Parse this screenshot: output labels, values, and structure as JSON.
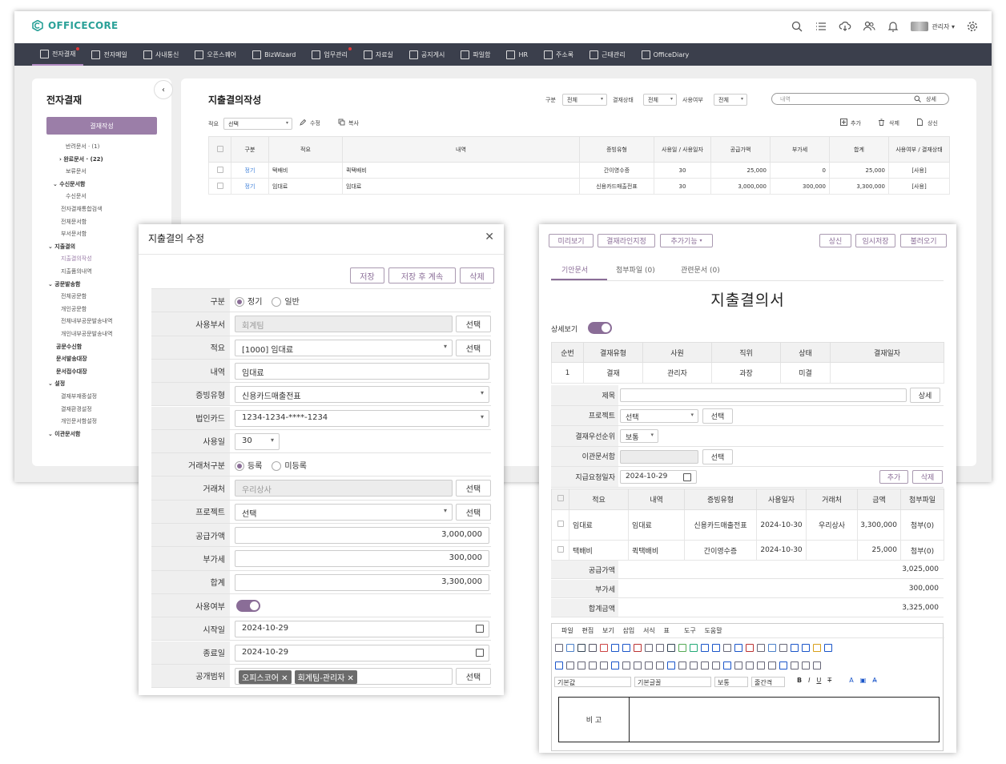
{
  "app": {
    "logo": "OFFICECORE",
    "user": "관리자 ▾"
  },
  "nav": [
    {
      "label": "전자결재",
      "dot": true
    },
    {
      "label": "전자메일",
      "dot": false
    },
    {
      "label": "사내통신",
      "dot": false
    },
    {
      "label": "오픈스퀘어",
      "dot": false
    },
    {
      "label": "BizWizard",
      "dot": false
    },
    {
      "label": "업무관리",
      "dot": true
    },
    {
      "label": "자료실",
      "dot": false
    },
    {
      "label": "공지게시",
      "dot": false
    },
    {
      "label": "파일함",
      "dot": false
    },
    {
      "label": "HR",
      "dot": false
    },
    {
      "label": "주소록",
      "dot": false
    },
    {
      "label": "근태관리",
      "dot": false
    },
    {
      "label": "OfficeDiary",
      "dot": false
    }
  ],
  "sidebar": {
    "title": "전자결재",
    "write": "결재작성",
    "items": [
      {
        "label": "반려문서 · (1)",
        "indent": 24,
        "style": ""
      },
      {
        "label": "› 완료문서 · (22)",
        "indent": 16,
        "style": "b"
      },
      {
        "label": "보류문서",
        "indent": 24,
        "style": ""
      },
      {
        "label": "⌄ 수신문서함",
        "indent": 8,
        "style": "b"
      },
      {
        "label": "수신문서",
        "indent": 24,
        "style": ""
      },
      {
        "label": "전자결재통합검색",
        "indent": 18,
        "style": ""
      },
      {
        "label": "전체문서함",
        "indent": 18,
        "style": ""
      },
      {
        "label": "부서문서함",
        "indent": 18,
        "style": ""
      },
      {
        "label": "⌄ 지출결의",
        "indent": 2,
        "style": "b"
      },
      {
        "label": "지출결의작성",
        "indent": 18,
        "style": "act"
      },
      {
        "label": "지출품의내역",
        "indent": 18,
        "style": ""
      },
      {
        "label": "⌄ 공문발송함",
        "indent": 2,
        "style": "b"
      },
      {
        "label": "전체공문함",
        "indent": 18,
        "style": ""
      },
      {
        "label": "개인공문함",
        "indent": 18,
        "style": ""
      },
      {
        "label": "전체내부공문발송내역",
        "indent": 18,
        "style": ""
      },
      {
        "label": "개인내부공문발송내역",
        "indent": 18,
        "style": ""
      },
      {
        "label": "공문수신함",
        "indent": 12,
        "style": "b"
      },
      {
        "label": "문서발송대장",
        "indent": 12,
        "style": "b"
      },
      {
        "label": "문서접수대장",
        "indent": 12,
        "style": "b"
      },
      {
        "label": "⌄ 설정",
        "indent": 2,
        "style": "b"
      },
      {
        "label": "결재부재중설정",
        "indent": 18,
        "style": ""
      },
      {
        "label": "결재환경설정",
        "indent": 18,
        "style": ""
      },
      {
        "label": "개인문서함설정",
        "indent": 18,
        "style": ""
      },
      {
        "label": "⌄ 이관문서함",
        "indent": 2,
        "style": "b"
      }
    ]
  },
  "list": {
    "title": "지출결의작성",
    "filters": {
      "gubun_label": "구분",
      "gubun": "전체",
      "status_label": "결재상태",
      "status": "전체",
      "use_label": "사용여부",
      "use": "전체"
    },
    "search_placeholder": "내역",
    "detail": "상세",
    "jeokyo_label": "적요",
    "jeokyo": "선택",
    "edit": "수정",
    "copy": "복사",
    "add": "추가",
    "delete": "삭제",
    "submit": "상신",
    "headers": [
      "구분",
      "적요",
      "내역",
      "증빙유형",
      "사용일 / 사용일자",
      "공급가액",
      "부가세",
      "합계",
      "사용여부 / 결재상태"
    ],
    "rows": [
      [
        "정기",
        "택배비",
        "퀵택배비",
        "간이영수증",
        "30",
        "25,000",
        "0",
        "25,000",
        "[사용]"
      ],
      [
        "정기",
        "임대료",
        "임대료",
        "신용카드매출전표",
        "30",
        "3,000,000",
        "300,000",
        "3,300,000",
        "[사용]"
      ]
    ]
  },
  "dialog": {
    "title": "지출결의 수정",
    "save": "저장",
    "save_continue": "저장 후 계속",
    "delete": "삭제",
    "select": "선택",
    "labels": {
      "gubun": "구분",
      "dept": "사용부서",
      "jeokyo": "적요",
      "detail": "내역",
      "proof": "증빙유형",
      "card": "법인카드",
      "useday": "사용일",
      "tradetype": "거래처구분",
      "vendor": "거래처",
      "project": "프로젝트",
      "supply": "공급가액",
      "vat": "부가세",
      "total": "합계",
      "use": "사용여부",
      "start": "시작일",
      "end": "종료일",
      "scope": "공개범위"
    },
    "gubun_opts": [
      "정기",
      "일반"
    ],
    "dept": "회계팀",
    "jeokyo": "[1000] 임대료",
    "detail": "임대료",
    "proof": "신용카드매출전표",
    "card": "1234-1234-****-1234",
    "useday": "30",
    "trade_opts": [
      "등록",
      "미등록"
    ],
    "vendor": "우리상사",
    "project": "선택",
    "supply": "3,000,000",
    "vat": "300,000",
    "total": "3,300,000",
    "start": "2024-10-29",
    "end": "2024-10-29",
    "scope_tags": [
      "오피스코어",
      "회계팀-관리자"
    ]
  },
  "right": {
    "preview": "미리보기",
    "approval_line": "결재라인지정",
    "extra": "추가기능",
    "submit": "상신",
    "temp_save": "임시저장",
    "load": "불러오기",
    "tabs": [
      "기안문서",
      "첨부파일 (0)",
      "관련문서 (0)"
    ],
    "title": "지출결의서",
    "detail_view": "상세보기",
    "approval_headers": [
      "순번",
      "결재유형",
      "사원",
      "직위",
      "상태",
      "결재일자"
    ],
    "approval_row": [
      "1",
      "결재",
      "관리자",
      "과장",
      "미결",
      ""
    ],
    "labels": {
      "subject": "제목",
      "project": "프로젝트",
      "priority": "결재우선순위",
      "transfer": "이관문서함",
      "paydate": "지급요청일자"
    },
    "detail_btn": "상세",
    "project": "선택",
    "select": "선택",
    "priority": "보통",
    "paydate": "2024-10-29",
    "add": "추가",
    "delete": "삭제",
    "items_headers": [
      "적요",
      "내역",
      "증빙유형",
      "사용일자",
      "거래처",
      "금액",
      "첨부파일"
    ],
    "items": [
      [
        "임대료",
        "임대료",
        "신용카드매출전표",
        "2024-10-30",
        "우리상사",
        "3,300,000",
        "첨부(0)"
      ],
      [
        "택배비",
        "퀵택배비",
        "간이영수증",
        "2024-10-30",
        "",
        "25,000",
        "첨부(0)"
      ]
    ],
    "sums": [
      {
        "label": "공급가액",
        "value": "3,025,000"
      },
      {
        "label": "부가세",
        "value": "300,000"
      },
      {
        "label": "합계금액",
        "value": "3,325,000"
      }
    ],
    "editor": {
      "menus": [
        "파일",
        "편집",
        "보기",
        "삽입",
        "서식",
        "표",
        "도구",
        "도움말"
      ],
      "font_style": "기본값",
      "font": "기본글꼴",
      "size": "보통",
      "line": "줄간격",
      "remark": "비 고"
    }
  }
}
